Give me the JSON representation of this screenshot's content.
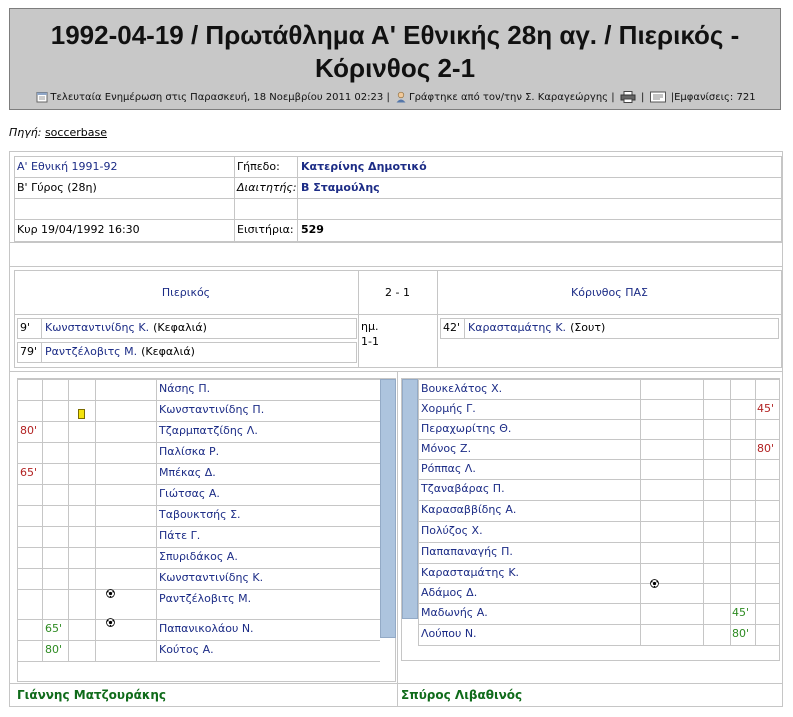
{
  "article": {
    "title_line1": "1992-04-19 / Πρωτάθλημα Α' Εθνικής 28η αγ. / Πιερικός -",
    "title_line2": "Κόρινθος 2-1",
    "updated": "Τελευταία Ενημέρωση στις Παρασκευή, 18 Νοεμβρίου 2011 02:23",
    "author": "Γράφτηκε από τον/την Σ. Καραγεώργης",
    "sep": "|",
    "views": "Εμφανίσεις: 721",
    "source_label": "Πηγή:",
    "source_link": "soccerbase"
  },
  "info": {
    "competition": "Α' Εθνική 1991-92",
    "round": "Β' Γύρος (28η)",
    "datetime": "Κυρ 19/04/1992 16:30",
    "stadium_label": "Γήπεδο:",
    "stadium": "Κατερίνης Δημοτικό",
    "referee_label": "Διαιτητής:",
    "referee": "Β Σταμούλης",
    "tickets_label": "Εισιτήρια:",
    "tickets": "529"
  },
  "score": {
    "home": "Πιερικός",
    "result": "2 - 1",
    "away": "Κόρινθος ΠΑΣ",
    "half_label": "ημ.",
    "half_score": "1-1",
    "home_goals": [
      {
        "min": "9'",
        "player": "Κωνσταντινίδης Κ.",
        "type": "(Κεφαλιά)"
      },
      {
        "min": "79'",
        "player": "Ραντζέλοβιτς Μ.",
        "type": "(Κεφαλιά)"
      }
    ],
    "away_goals": [
      {
        "min": "42'",
        "player": "Καρασταμάτης Κ.",
        "type": "(Σουτ)"
      }
    ]
  },
  "home_lineup": [
    {
      "out": "",
      "in": "",
      "name": "Νάσης Π."
    },
    {
      "out": "",
      "in": "",
      "name": "Κωνσταντινίδης Π."
    },
    {
      "out": "80'",
      "in": "",
      "name": "Τζαρμπατζίδης Λ."
    },
    {
      "out": "",
      "in": "",
      "name": "Παλίσκα Ρ."
    },
    {
      "out": "65'",
      "in": "",
      "name": "Μπέκας Δ."
    },
    {
      "out": "",
      "in": "",
      "name": "Γιώτσας Α."
    },
    {
      "out": "",
      "in": "",
      "name": "Ταβουκτσής Σ."
    },
    {
      "out": "",
      "in": "",
      "name": "Πάτε Γ."
    },
    {
      "out": "",
      "in": "",
      "name": "Σπυριδάκος Α."
    },
    {
      "out": "",
      "in": "",
      "name": "Κωνσταντινίδης Κ."
    },
    {
      "out": "",
      "in": "",
      "name": "Ραντζέλοβιτς Μ."
    },
    {
      "out": "",
      "in": "65'",
      "name": "Παπανικολάου Ν."
    },
    {
      "out": "",
      "in": "80'",
      "name": "Κούτος Α."
    }
  ],
  "away_lineup": [
    {
      "name": "Βουκελάτος Χ.",
      "out": "",
      "in": ""
    },
    {
      "name": "Χορμής Γ.",
      "out": "45'",
      "in": ""
    },
    {
      "name": "Περαχωρίτης Θ.",
      "out": "",
      "in": ""
    },
    {
      "name": "Μόνος Ζ.",
      "out": "80'",
      "in": ""
    },
    {
      "name": "Ρόππας Λ.",
      "out": "",
      "in": ""
    },
    {
      "name": "Τζαναβάρας Π.",
      "out": "",
      "in": ""
    },
    {
      "name": "Καρασαββίδης Α.",
      "out": "",
      "in": ""
    },
    {
      "name": "Πολύζος Χ.",
      "out": "",
      "in": ""
    },
    {
      "name": "Παπαπαναγής Π.",
      "out": "",
      "in": ""
    },
    {
      "name": "Καρασταμάτης Κ.",
      "out": "",
      "in": ""
    },
    {
      "name": "Αδάμος Δ.",
      "out": "",
      "in": ""
    },
    {
      "name": "Μαδωνής Α.",
      "out": "",
      "in": "45'"
    },
    {
      "name": "Λούπου Ν.",
      "out": "",
      "in": "80'"
    }
  ],
  "coaches": {
    "home": "Γιάννης Ματζουράκης",
    "away": "Σπύρος Λιβαθινός"
  },
  "icons": {
    "updated": "calendar-icon",
    "author": "user-icon",
    "print": "printer-icon",
    "email": "email-icon",
    "goal": "football-icon",
    "card": "yellow-card-icon"
  },
  "colors": {
    "header_bg": "#c8c8c8",
    "link": "#1c2c86",
    "sub_out": "#b22222",
    "sub_in": "#2e8b22",
    "coach": "#0f6b1a",
    "yellow_card": "#f4e30c"
  }
}
